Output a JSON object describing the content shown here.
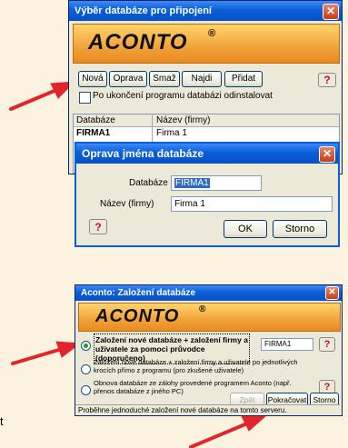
{
  "window1": {
    "title": "Výběr databáze pro připojení",
    "logo": "ACONTO",
    "logo_mark": "®",
    "buttons": [
      "Nová",
      "Oprava",
      "Smaž",
      "Najdi",
      "Přidat"
    ],
    "help": "?",
    "checkbox_label": "Po ukončení programu databázi odinstalovat",
    "checkbox_checked": false,
    "table": {
      "headers": [
        "Databáze",
        "Název (firmy)"
      ],
      "rows": [
        [
          "FIRMA1",
          "Firma 1"
        ]
      ]
    }
  },
  "dialog": {
    "title": "Oprava jména databáze",
    "db_label": "Databáze",
    "db_value": "FIRMA1",
    "name_label": "Název (firmy)",
    "name_value": "Firma 1",
    "help": "?",
    "ok": "OK",
    "cancel": "Storno"
  },
  "window2": {
    "title": "Aconto: Založení databáze",
    "logo": "ACONTO",
    "logo_mark": "®",
    "options": [
      {
        "text": "Založení nové databáze + založení firmy a uživatele za pomoci průvodce (doporučeno)",
        "selected": true
      },
      {
        "text": "Založení nové databáze + založení firmy a uživatele po jednotlivých krocích přímo z programu (pro zkušené uživatele)",
        "selected": false
      },
      {
        "text": "Obnova databáze ze zálohy provedené programem Aconto (např. přenos databáze z jiného PC)",
        "selected": false
      }
    ],
    "db_value": "FIRMA1",
    "help": "?",
    "back": "Zpět",
    "next": "Pokračovat",
    "cancel": "Storno",
    "status": "Proběhne jednoduché založení nové databáze na tomto serveru."
  },
  "left_fragment": "t",
  "colors": {
    "accent": "#0a5fd8",
    "arrow": "#e0262b",
    "selection": "#316ac5"
  }
}
